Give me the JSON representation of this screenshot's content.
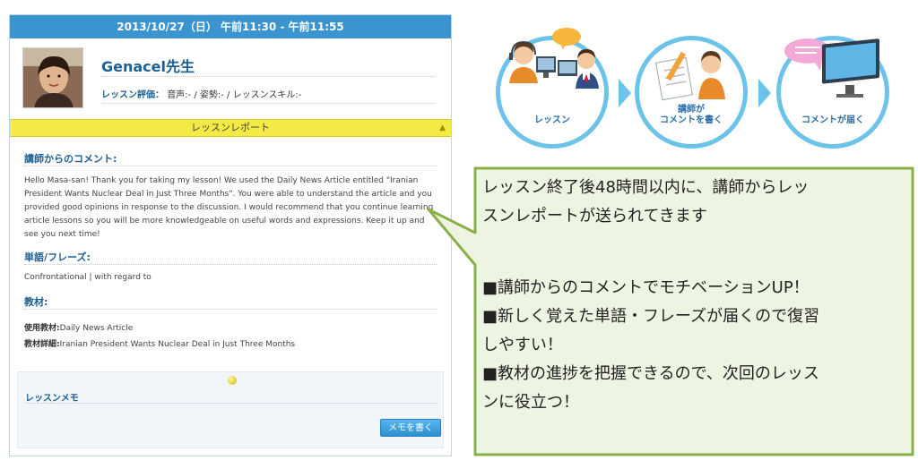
{
  "panel": {
    "header": "2013/10/27（日） 午前11:30 - 午前11:55",
    "teacher_name": "Genacel先生",
    "rating_label": "レッスン評価：",
    "rating_value": "音声:- / 姿勢:- / レッスンスキル:-",
    "report_bar_label": "レッスンレポート",
    "report_toggle": "▲",
    "comment_title": "講師からのコメント:",
    "comment_text": "Hello Masa-san! Thank you for taking my lesson! We used the Daily News Article entitled \"Iranian President Wants Nuclear Deal in Just Three Months\". You were able to understand the article and you provided good opinions in response to the discussion. I would recommend that you continue learning article lessons so you will be more knowledgeable on useful words and expressions. Keep it up and see you next time!",
    "vocab_title": "単語/フレーズ:",
    "vocab_text": "Confrontational | with regard to",
    "material_title": "教材:",
    "material_used_label": "使用教材:",
    "material_used_value": "Daily News Article",
    "material_detail_label": "教材詳細:",
    "material_detail_value": "Iranian President Wants Nuclear Deal in Just Three Months",
    "memo_title": "レッスンメモ",
    "memo_button": "メモを書く"
  },
  "flow": [
    {
      "label": "レッスン",
      "icon": "headset-teacher-student-icon"
    },
    {
      "label_line1": "講師が",
      "label_line2": "コメントを書く",
      "icon": "writing-teacher-icon"
    },
    {
      "label": "コメントが届く",
      "icon": "monitor-message-icon"
    }
  ],
  "bubble": {
    "line1": "レッスン終了後48時間以内に、講師からレッ",
    "line2": "スンレポートが送られてきます",
    "bullet1": "■講師からのコメントでモチベーションUP！",
    "bullet2a": "■新しく覚えた単語・フレーズが届くので復習",
    "bullet2b": "しやすい！",
    "bullet3a": "■教材の進捗を把握できるので、次回のレッス",
    "bullet3b": "ンに役立つ！"
  },
  "colors": {
    "header_blue": "#3a94cf",
    "accent_blue": "#1d5f93",
    "report_yellow": "#f4ea45",
    "bubble_fill": "#eef4e2",
    "bubble_border": "#8ab04a",
    "flow_cyan": "#6cc3e9"
  }
}
